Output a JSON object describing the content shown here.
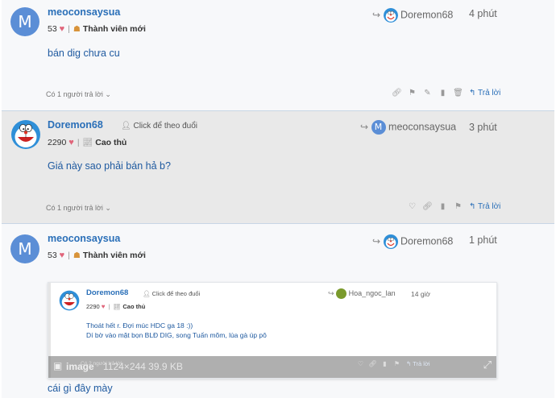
{
  "posts": [
    {
      "author": "meoconsaysua",
      "avatar_letter": "M",
      "likes": "53",
      "rank": "Thành viên mới",
      "reply_to": "Doremon68",
      "time": "4 phút",
      "body": "bán dig chưa cu",
      "replies": "Có 1 người trả lời",
      "reply_label": "Trả lời"
    },
    {
      "author": "Doremon68",
      "follow": "Click để theo đuổi",
      "likes": "2290",
      "rank": "Cao thủ",
      "reply_to": "meoconsaysua",
      "reply_to_letter": "M",
      "time": "3 phút",
      "body": "Giá này sao phải bán hả b?",
      "replies": "Có 1 người trả lời",
      "reply_label": "Trả lời"
    },
    {
      "author": "meoconsaysua",
      "avatar_letter": "M",
      "likes": "53",
      "rank": "Thành viên mới",
      "reply_to": "Doremon68",
      "time": "1 phút",
      "body": "cái gì đây mày",
      "quote": {
        "author": "Doremon68",
        "follow": "Click để theo đuổi",
        "likes": "2290",
        "rank": "Cao thủ",
        "reply_to": "Hoa_ngoc_lan",
        "time": "14 giờ",
        "line1": "Thoát hết r. Đợi múc HDC ga 18 :))",
        "line2": "Dí bờ vào mặt bọn BLĐ DIG, song Tuấn mõm, lùa gà úp pô",
        "replies": "Có 2 người trả lời",
        "reply_label": "Trả lời",
        "image_label": "image",
        "image_info": "1124×244 39.9 KB"
      }
    }
  ]
}
